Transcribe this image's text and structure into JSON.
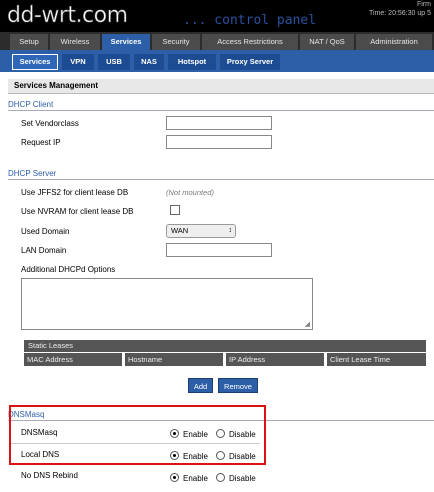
{
  "header": {
    "logo": "dd-wrt.com",
    "subtitle": "... control panel",
    "firmware": "Firm",
    "time": "Time: 20:56:30 up 5"
  },
  "top_tabs": [
    "Setup",
    "Wireless",
    "Services",
    "Security",
    "Access Restrictions",
    "NAT / QoS",
    "Administration"
  ],
  "sub_tabs": [
    "Services",
    "VPN",
    "USB",
    "NAS",
    "Hotspot",
    "Proxy Server"
  ],
  "page": {
    "title": "Services Management"
  },
  "dhcp_client": {
    "heading": "DHCP Client",
    "vendorclass_label": "Set Vendorclass",
    "vendorclass_value": "",
    "request_ip_label": "Request IP",
    "request_ip_value": ""
  },
  "dhcp_server": {
    "heading": "DHCP Server",
    "jffs2_label": "Use JFFS2 for client lease DB",
    "jffs2_value": "(Not mounted)",
    "nvram_label": "Use NVRAM for client lease DB",
    "used_domain_label": "Used Domain",
    "used_domain_value": "WAN",
    "lan_domain_label": "LAN Domain",
    "lan_domain_value": "",
    "additional_options_label": "Additional DHCPd Options",
    "additional_options_value": ""
  },
  "static_leases": {
    "title": "Static Leases",
    "columns": [
      "MAC Address",
      "Hostname",
      "IP Address",
      "Client Lease Time"
    ],
    "add_label": "Add",
    "remove_label": "Remove"
  },
  "dnsmasq": {
    "heading": "DNSMasq",
    "dnsmasq_label": "DNSMasq",
    "local_dns_label": "Local DNS",
    "no_dns_rebind_label": "No DNS Rebind",
    "enable_label": "Enable",
    "disable_label": "Disable"
  },
  "colors": {
    "accent": "#2d5fa8",
    "highlight_box": "#dd1111"
  }
}
